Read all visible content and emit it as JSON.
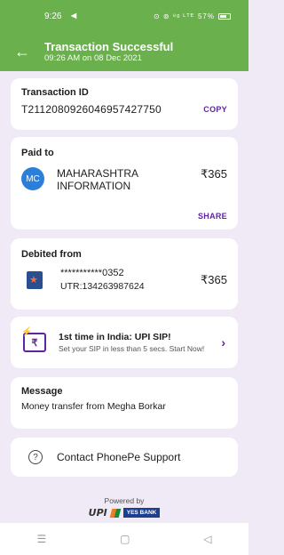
{
  "status_bar": {
    "time": "9:26",
    "send_glyph": "◄",
    "right_icons": "⊙ ⊚ ⁸ᵍ ᴸᵀᴱ",
    "battery": "57%"
  },
  "header": {
    "title": "Transaction Successful",
    "subtitle": "09:26 AM on 08 Dec 2021",
    "back_glyph": "←"
  },
  "transaction": {
    "label": "Transaction ID",
    "id": "T2112080926046957427750",
    "copy_label": "COPY"
  },
  "paid_to": {
    "label": "Paid to",
    "initials": "MC",
    "name": "MAHARASHTRA INFORMATION",
    "amount": "₹365",
    "share_label": "SHARE"
  },
  "debited_from": {
    "label": "Debited from",
    "account": "***********0352",
    "utr": "UTR:134263987624",
    "amount": "₹365"
  },
  "promo": {
    "title": "1st time in India: UPI SIP!",
    "subtitle": "Set your SIP in less than 5 secs. Start Now!",
    "icon_glyph": "₹"
  },
  "message": {
    "label": "Message",
    "text": "Money transfer from Megha Borkar"
  },
  "support": {
    "label": "Contact PhonePe Support"
  },
  "footer": {
    "powered_by": "Powered by",
    "upi_text": "UPI",
    "bank_text": "YES BANK"
  },
  "nav": {
    "menu": "☰",
    "home": "▢",
    "back": "◁"
  },
  "colors": {
    "header_green": "#6ab04c",
    "accent_purple": "#5f259f",
    "background": "#efeaf5"
  }
}
